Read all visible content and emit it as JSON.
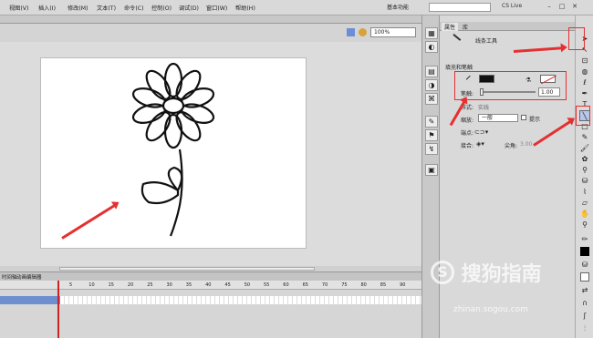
{
  "menu": [
    "视图(V)",
    "插入(I)",
    "修改(M)",
    "文本(T)",
    "命令(C)",
    "控制(O)",
    "调试(D)",
    "窗口(W)",
    "帮助(H)"
  ],
  "workspace": "基本功能",
  "cslive": "CS Live",
  "zoom": "100%",
  "props": {
    "tab_properties": "属性",
    "tab_library": "库",
    "tool_name": "线条工具",
    "section": "填充和笔触",
    "stroke_label": "笔触:",
    "stroke_value": "1.00",
    "style_label": "样式:",
    "style_value": "实线",
    "scale_label": "缩放:",
    "scale_value": "一般",
    "hint_label": "提示",
    "cap_label": "端点:",
    "join_label": "接合:",
    "miter_label": "尖角:",
    "miter_value": "3.00"
  },
  "timeline": {
    "tab1": "时间轴",
    "tab2": "动画编辑器",
    "frame_numbers": [
      "5",
      "10",
      "15",
      "20",
      "25",
      "30",
      "35",
      "40",
      "45",
      "50",
      "55",
      "60",
      "65",
      "70",
      "75",
      "80",
      "85",
      "90"
    ]
  },
  "watermark": "搜狗指南",
  "watermark_url": "zhinan.sogou.com",
  "colors": {
    "accent": "#e53030",
    "layer_selected": "#6d8fd0"
  }
}
